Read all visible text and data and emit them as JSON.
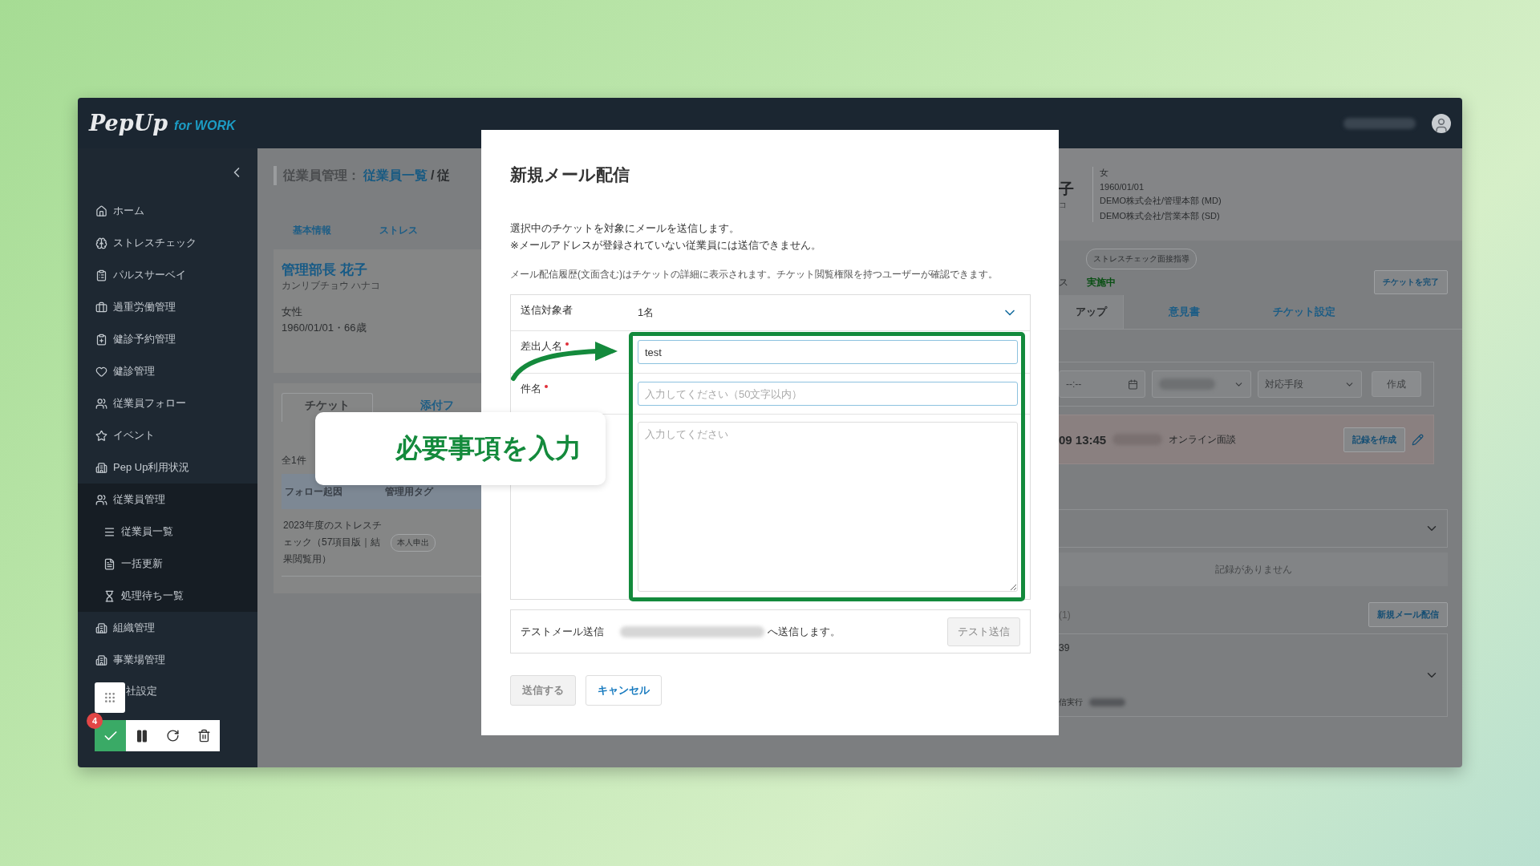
{
  "header": {
    "logo": "PepUp",
    "logo_suffix": "for WORK"
  },
  "sidebar": {
    "items": [
      {
        "label": "ホーム"
      },
      {
        "label": "ストレスチェック"
      },
      {
        "label": "パルスサーベイ"
      },
      {
        "label": "過重労働管理"
      },
      {
        "label": "健診予約管理"
      },
      {
        "label": "健診管理"
      },
      {
        "label": "従業員フォロー"
      },
      {
        "label": "イベント"
      },
      {
        "label": "Pep Up利用状況"
      },
      {
        "label": "従業員管理",
        "expanded": true,
        "children": [
          {
            "label": "従業員一覧"
          },
          {
            "label": "一括更新"
          },
          {
            "label": "処理待ち一覧"
          }
        ]
      },
      {
        "label": "組織管理"
      },
      {
        "label": "事業場管理"
      },
      {
        "label": "社設定"
      }
    ]
  },
  "toolbar": {
    "badge": "4"
  },
  "breadcrumb": {
    "section": "従業員管理：",
    "link": "従業員一覧",
    "separator": "/",
    "rest": "従"
  },
  "profile_tabs": [
    {
      "label": "基本情報"
    },
    {
      "label": "ストレス"
    }
  ],
  "profile": {
    "name": "管理部長 花子",
    "kana": "カンリブチョウ ハナコ",
    "gender": "女性",
    "birth": "1960/01/01・66歳"
  },
  "ticket_tabs": [
    {
      "label": "チケット",
      "selected": true
    },
    {
      "label": "添付フ",
      "selected": false
    }
  ],
  "ticket_count": "全1件",
  "table": {
    "columns": [
      "フォロー起因",
      "管理用タグ"
    ],
    "rows": [
      {
        "cause": "2023年度のストレスチェック（57項目版｜結果閲覧用）",
        "tag": "本人申出"
      }
    ]
  },
  "detail": {
    "name_part": "子",
    "kana_part": "コ",
    "info": [
      "女",
      "1960/01/01",
      "DEMO株式会社/管理本部 (MD)",
      "DEMO株式会社/営業本部 (SD)"
    ],
    "tag": "ストレスチェック面接指導",
    "status_label": "ス",
    "status": "実施中",
    "complete_button": "チケットを完了",
    "tabs": [
      {
        "label": "アップ",
        "selected": true
      },
      {
        "label": "意見書",
        "selected": false
      },
      {
        "label": "チケット設定",
        "selected": false
      }
    ],
    "time_field": "--:--",
    "method_select": "対応手段",
    "create_button": {
      "label": "作成",
      "disabled": true
    },
    "appointment": {
      "time": "09 13:45",
      "type": "オンライン面談",
      "button": "記録を作成"
    },
    "records_empty": "記録がありません",
    "mail_count": "(1)",
    "new_mail_button": "新規メール配信",
    "mail_item": {
      "date": "39",
      "sent_label": "信実行"
    }
  },
  "modal": {
    "title": "新規メール配信",
    "description": [
      "選択中のチケットを対象にメールを送信します。",
      "※メールアドレスが登録されていない従業員には送信できません。"
    ],
    "note": "メール配信履歴(文面含む)はチケットの詳細に表示されます。チケット閲覧権限を持つユーザーが確認できます。",
    "fields": [
      {
        "kind": "select",
        "label": "送信対象者",
        "value": "1名"
      },
      {
        "kind": "input",
        "label": "差出人名",
        "required": true,
        "value": "test"
      },
      {
        "kind": "input",
        "label": "件名",
        "required": true,
        "placeholder": "入力してください（50文字以内）"
      },
      {
        "kind": "textarea",
        "placeholder": "入力してください"
      }
    ],
    "test_mail": {
      "label": "テストメール送信",
      "suffix": "へ送信します。",
      "button": {
        "label": "テスト送信",
        "disabled": true
      }
    },
    "actions": [
      {
        "label": "送信する",
        "disabled": true
      },
      {
        "label": "キャンセル",
        "disabled": false
      }
    ]
  },
  "callout": {
    "text": "必要事項を入力"
  }
}
